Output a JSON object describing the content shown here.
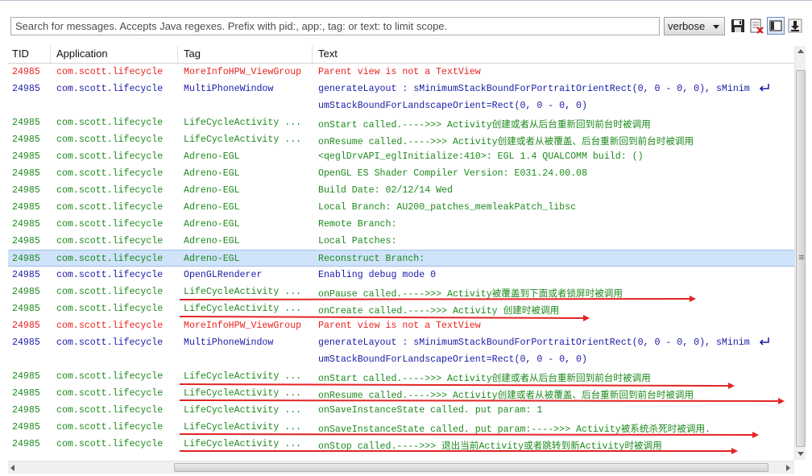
{
  "toolbar": {
    "search_placeholder": "Search for messages. Accepts Java regexes. Prefix with pid:, app:, tag: or text: to limit scope.",
    "log_level": "verbose"
  },
  "columns": {
    "tid": "TID",
    "application": "Application",
    "tag": "Tag",
    "text": "Text"
  },
  "colors": {
    "error": "#e8231f",
    "info": "#1e8a1e",
    "debug": "#1a1aa8",
    "selected_bg": "#cfe3fb",
    "annotation_arrow": "#e32424"
  },
  "rows": [
    {
      "tid": "24985",
      "app": "com.scott.lifecycle",
      "tag": "MoreInfoHPW_ViewGroup",
      "text": "Parent view is not a TextView",
      "level": "error"
    },
    {
      "tid": "24985",
      "app": "com.scott.lifecycle",
      "tag": "MultiPhoneWindow",
      "text": "generateLayout : sMinimumStackBoundForPortraitOrientRect(0, 0 - 0, 0), sMinim",
      "level": "debug",
      "wrapped": true
    },
    {
      "tid": "",
      "app": "",
      "tag": "",
      "text": "umStackBoundForLandscapeOrient=Rect(0, 0 - 0, 0)",
      "level": "debug"
    },
    {
      "tid": "24985",
      "app": "com.scott.lifecycle",
      "tag": "LifeCycleActivity ...",
      "text": "onStart called.---->>> Activity创建或者从后台重新回到前台时被调用",
      "level": "info"
    },
    {
      "tid": "24985",
      "app": "com.scott.lifecycle",
      "tag": "LifeCycleActivity ...",
      "text": "onResume called.---->>> Activity创建或者从被覆盖、后台重新回到前台时被调用",
      "level": "info"
    },
    {
      "tid": "24985",
      "app": "com.scott.lifecycle",
      "tag": "Adreno-EGL",
      "text": "<qeglDrvAPI_eglInitialize:410>: EGL 1.4 QUALCOMM build:  ()",
      "level": "info"
    },
    {
      "tid": "24985",
      "app": "com.scott.lifecycle",
      "tag": "Adreno-EGL",
      "text": "OpenGL ES Shader Compiler Version: E031.24.00.08",
      "level": "info"
    },
    {
      "tid": "24985",
      "app": "com.scott.lifecycle",
      "tag": "Adreno-EGL",
      "text": "Build Date: 02/12/14 Wed",
      "level": "info"
    },
    {
      "tid": "24985",
      "app": "com.scott.lifecycle",
      "tag": "Adreno-EGL",
      "text": "Local Branch: AU200_patches_memleakPatch_libsc",
      "level": "info"
    },
    {
      "tid": "24985",
      "app": "com.scott.lifecycle",
      "tag": "Adreno-EGL",
      "text": "Remote Branch:",
      "level": "info"
    },
    {
      "tid": "24985",
      "app": "com.scott.lifecycle",
      "tag": "Adreno-EGL",
      "text": "Local Patches:",
      "level": "info"
    },
    {
      "tid": "24985",
      "app": "com.scott.lifecycle",
      "tag": "Adreno-EGL",
      "text": "Reconstruct Branch:",
      "level": "info",
      "selected": true
    },
    {
      "tid": "24985",
      "app": "com.scott.lifecycle",
      "tag": "OpenGLRenderer",
      "text": "Enabling debug mode 0",
      "level": "debug"
    },
    {
      "tid": "24985",
      "app": "com.scott.lifecycle",
      "tag": "LifeCycleActivity ...",
      "text": "onPause called.---->>> Activity被覆盖到下面或者锁屏时被调用",
      "level": "info"
    },
    {
      "tid": "24985",
      "app": "com.scott.lifecycle",
      "tag": "LifeCycleActivity ...",
      "text": "onCreate called.---->>> Activity 创建时被调用",
      "level": "info"
    },
    {
      "tid": "24985",
      "app": "com.scott.lifecycle",
      "tag": "MoreInfoHPW_ViewGroup",
      "text": "Parent view is not a TextView",
      "level": "error"
    },
    {
      "tid": "24985",
      "app": "com.scott.lifecycle",
      "tag": "MultiPhoneWindow",
      "text": "generateLayout : sMinimumStackBoundForPortraitOrientRect(0, 0 - 0, 0), sMinim",
      "level": "debug",
      "wrapped": true
    },
    {
      "tid": "",
      "app": "",
      "tag": "",
      "text": "umStackBoundForLandscapeOrient=Rect(0, 0 - 0, 0)",
      "level": "debug"
    },
    {
      "tid": "24985",
      "app": "com.scott.lifecycle",
      "tag": "LifeCycleActivity ...",
      "text": "onStart called.---->>> Activity创建或者从后台重新回到前台时被调用",
      "level": "info"
    },
    {
      "tid": "24985",
      "app": "com.scott.lifecycle",
      "tag": "LifeCycleActivity ...",
      "text": "onResume called.---->>> Activity创建或者从被覆盖、后台重新回到前台时被调用",
      "level": "info"
    },
    {
      "tid": "24985",
      "app": "com.scott.lifecycle",
      "tag": "LifeCycleActivity ...",
      "text": "onSaveInstanceState called. put param: 1",
      "level": "info"
    },
    {
      "tid": "24985",
      "app": "com.scott.lifecycle",
      "tag": "LifeCycleActivity ...",
      "text": "onSaveInstanceState called. put param:---->>> Activity被系统杀死时被调用.",
      "level": "info"
    },
    {
      "tid": "24985",
      "app": "com.scott.lifecycle",
      "tag": "LifeCycleActivity ...",
      "text": "onStop called.---->>> 退出当前Activity或者跳转到新Activity时被调用",
      "level": "info"
    }
  ]
}
